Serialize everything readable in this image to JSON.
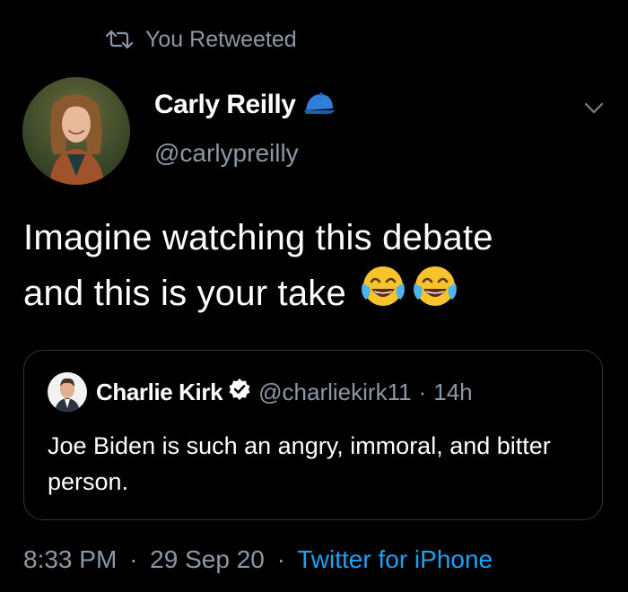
{
  "retweet": {
    "icon": "retweet-icon",
    "label": "You Retweeted"
  },
  "author": {
    "name": "Carly Reilly",
    "handle": "@carlypreilly",
    "badge_icon": "blue-cap-icon",
    "avatar_icon": "avatar-photo"
  },
  "tweet": {
    "line1": "Imagine watching this debate",
    "line2": "and this is your take",
    "emojis": [
      "face-with-tears-of-joy-icon",
      "face-with-tears-of-joy-icon"
    ]
  },
  "quoted": {
    "name": "Charlie Kirk",
    "verified_icon": "verified-badge-icon",
    "handle": "@charliekirk11",
    "separator": "·",
    "time": "14h",
    "text": "Joe Biden is such an angry, immoral, and bitter person."
  },
  "footer": {
    "time": "8:33 PM",
    "separator": "·",
    "date": "29 Sep 20",
    "source": "Twitter for iPhone"
  },
  "colors": {
    "background": "#000000",
    "text": "#ffffff",
    "muted": "#8b98a5",
    "accent": "#1da1f2",
    "border": "#2f3336"
  }
}
